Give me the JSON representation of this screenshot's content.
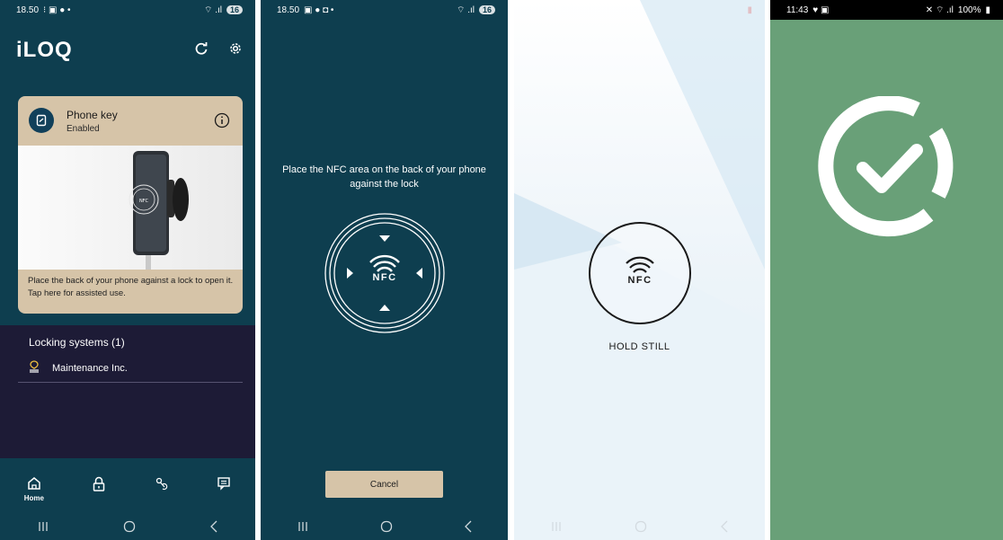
{
  "screen_home": {
    "status_time": "18.50",
    "status_badge": "16",
    "app_name": "iLOQ",
    "card": {
      "title": "Phone key",
      "status": "Enabled",
      "instruction": "Place the back of your phone against a lock to open it. Tap here for assisted use."
    },
    "locking_systems": {
      "title": "Locking systems (1)",
      "items": [
        "Maintenance Inc."
      ]
    },
    "nav": {
      "home_label": "Home"
    }
  },
  "screen_nfc_prompt": {
    "status_time": "18.50",
    "status_badge": "16",
    "instruction": "Place the NFC area on the back of your phone against the lock",
    "nfc_label": "NFC",
    "cancel_label": "Cancel"
  },
  "screen_hold": {
    "nfc_label": "NFC",
    "status_text": "HOLD STILL"
  },
  "screen_success": {
    "status_time": "11:43",
    "battery": "100%"
  },
  "colors": {
    "app_teal": "#0e3e4f",
    "card_beige": "#d6c4a8",
    "navy_panel": "#1d1b36",
    "success_green": "#69a078"
  }
}
